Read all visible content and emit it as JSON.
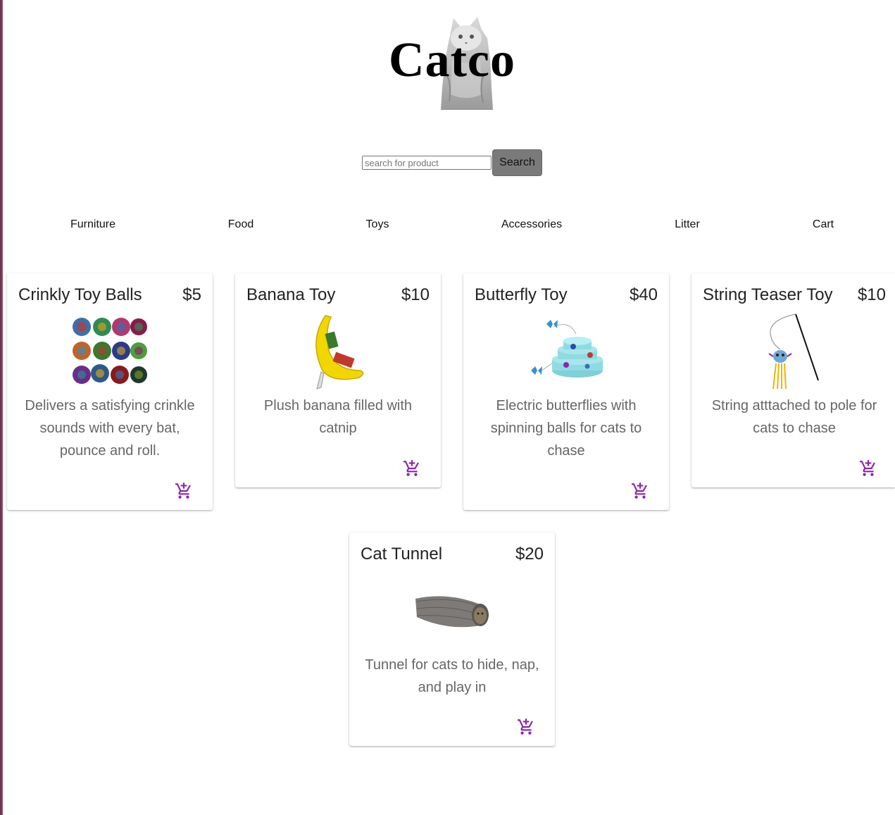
{
  "brand": {
    "title": "Catco"
  },
  "search": {
    "placeholder": "search for product",
    "button_label": "Search"
  },
  "nav": {
    "items": [
      {
        "label": "Furniture"
      },
      {
        "label": "Food"
      },
      {
        "label": "Toys"
      },
      {
        "label": "Accessories"
      },
      {
        "label": "Litter"
      },
      {
        "label": "Cart"
      }
    ]
  },
  "theme": {
    "accent": "#8e24aa",
    "search_button_bg": "#7a7a7a"
  },
  "products": [
    {
      "name": "Crinkly Toy Balls",
      "price": "$5",
      "description": "Delivers a satisfying crinkle sounds with every bat, pounce and roll.",
      "image_icon": "crinkle-balls-image",
      "cart_icon": "add-to-cart-icon"
    },
    {
      "name": "Banana Toy",
      "price": "$10",
      "description": "Plush banana filled with catnip",
      "image_icon": "banana-toy-image",
      "cart_icon": "add-to-cart-icon"
    },
    {
      "name": "Butterfly Toy",
      "price": "$40",
      "description": "Electric butterflies with spinning balls for cats to chase",
      "image_icon": "butterfly-toy-image",
      "cart_icon": "add-to-cart-icon"
    },
    {
      "name": "String Teaser Toy",
      "price": "$10",
      "description": "String atttached to pole for cats to chase",
      "image_icon": "string-teaser-image",
      "cart_icon": "add-to-cart-icon"
    },
    {
      "name": "Cat Tunnel",
      "price": "$20",
      "description": "Tunnel for cats to hide, nap, and play in",
      "image_icon": "cat-tunnel-image",
      "cart_icon": "add-to-cart-icon"
    }
  ]
}
